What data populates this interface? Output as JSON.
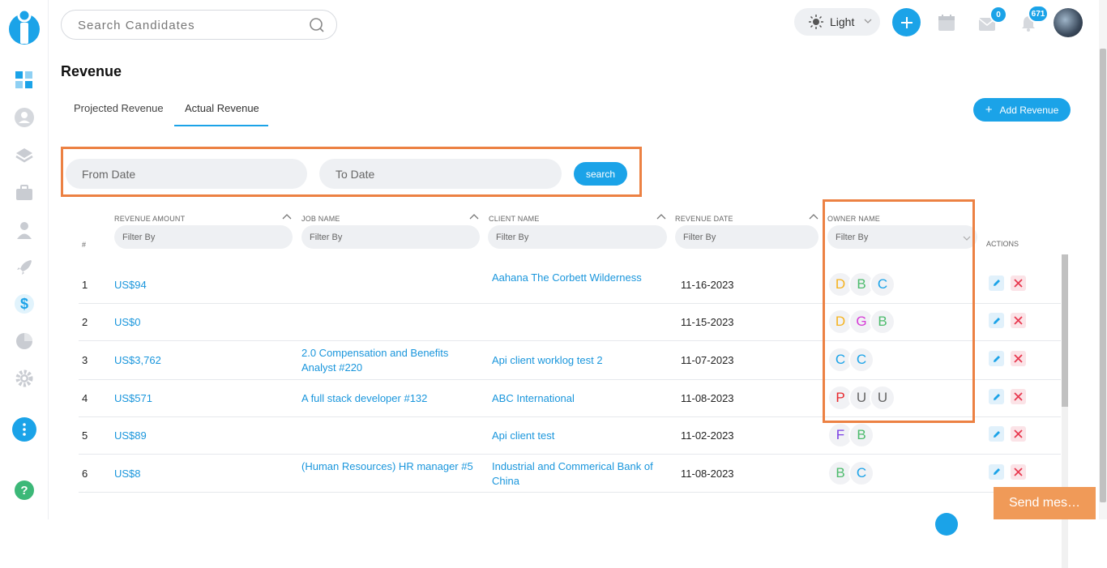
{
  "colors": {
    "accent": "#1ba3e8",
    "highlight": "#ec8143",
    "link": "#1a96dc",
    "send": "#f09a58"
  },
  "topbar": {
    "search_placeholder": "Search Candidates",
    "theme_label": "Light",
    "messages_count": "0",
    "notifications_count": "671"
  },
  "page": {
    "title": "Revenue",
    "tabs": [
      {
        "label": "Projected Revenue"
      },
      {
        "label": "Actual Revenue"
      }
    ],
    "add_button": "Add Revenue"
  },
  "date_filter": {
    "from_placeholder": "From Date",
    "to_placeholder": "To Date",
    "search_label": "search"
  },
  "table": {
    "hash": "#",
    "columns": [
      {
        "label": "REVENUE AMOUNT",
        "filter": "Filter By"
      },
      {
        "label": "JOB NAME",
        "filter": "Filter By"
      },
      {
        "label": "CLIENT NAME",
        "filter": "Filter By"
      },
      {
        "label": "REVENUE DATE",
        "filter": "Filter By"
      },
      {
        "label": "OWNER NAME",
        "filter": "Filter By"
      }
    ],
    "actions_label": "ACTIONS",
    "rows": [
      {
        "num": "1",
        "amount": "US$94",
        "job": "",
        "client": "Aahana The Corbett Wilderness",
        "date": "11-16-2023",
        "owners": [
          {
            "l": "D",
            "c": "#f5b21d"
          },
          {
            "l": "B",
            "c": "#4cbb6c"
          },
          {
            "l": "C",
            "c": "#1ba3e8"
          }
        ]
      },
      {
        "num": "2",
        "amount": "US$0",
        "job": "",
        "client": "",
        "date": "11-15-2023",
        "owners": [
          {
            "l": "D",
            "c": "#f5b21d"
          },
          {
            "l": "G",
            "c": "#d63ad6"
          },
          {
            "l": "B",
            "c": "#4cbb6c"
          }
        ]
      },
      {
        "num": "3",
        "amount": "US$3,762",
        "job": "2.0 Compensation and Benefits Analyst #220",
        "client": "Api client worklog test 2",
        "date": "11-07-2023",
        "owners": [
          {
            "l": "C",
            "c": "#1ba3e8"
          },
          {
            "l": "C",
            "c": "#1ba3e8"
          }
        ]
      },
      {
        "num": "4",
        "amount": "US$571",
        "job": "A full stack developer #132",
        "client": "ABC International",
        "date": "11-08-2023",
        "owners": [
          {
            "l": "P",
            "c": "#e8282d"
          },
          {
            "l": "U",
            "c": "#666666"
          },
          {
            "l": "U",
            "c": "#666666"
          }
        ]
      },
      {
        "num": "5",
        "amount": "US$89",
        "job": "",
        "client": "Api client test",
        "date": "11-02-2023",
        "owners": [
          {
            "l": "F",
            "c": "#7b3fe4"
          },
          {
            "l": "B",
            "c": "#4cbb6c"
          }
        ]
      },
      {
        "num": "6",
        "amount": "US$8",
        "job": "(Human Resources) HR manager #5",
        "client": "Industrial and Commerical Bank of China",
        "date": "11-08-2023",
        "owners": [
          {
            "l": "B",
            "c": "#4cbb6c"
          },
          {
            "l": "C",
            "c": "#1ba3e8"
          }
        ]
      }
    ]
  },
  "send_message": "Send mes…"
}
